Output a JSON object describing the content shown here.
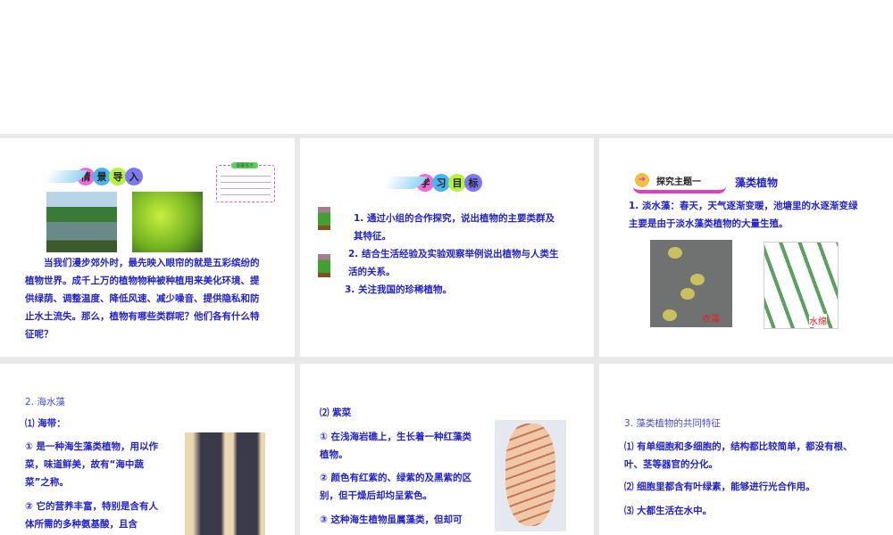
{
  "slides": [
    {
      "badge": [
        "情",
        "景",
        "导",
        "入"
      ],
      "note_title": "温馨提示",
      "text": "　　当我们漫步郊外时，最先映入眼帘的就是五彩缤纷的植物世界。成千上万的植物物种被种植用来美化环境、提供绿荫、调整温度、降低风速、减少噪音、提供隐私和防止水土流失。那么，植物有哪些类群呢？他们各有什么特征呢？"
    },
    {
      "badge": [
        "学",
        "习",
        "目",
        "标"
      ],
      "items": [
        "1. 通过小组的合作探究，说出植物的主要类群及其特征。",
        "2. 结合生活经验及实验观察举例说出植物与人类生活的关系。",
        "3. 关注我国的珍稀植物。"
      ]
    },
    {
      "badge_text": "探究主题一",
      "title": "藻类植物",
      "text": "1. 淡水藻：春天，天气逐渐变暖，池塘里的水逐渐变绿主要是由于淡水藻类植物的大量生殖。",
      "caption1": "衣藻",
      "caption2": "水绵"
    },
    {
      "heading": "2. 海水藻",
      "sub": "⑴ 海带：",
      "p1": "① 是一种海生藻类植物，用以作菜，味道鲜美，故有“海中蔬菜”之称。",
      "p2": "② 它的营养丰富，特别是含有人体所需的多种氨基酸，且含"
    },
    {
      "sub": "⑵ 紫菜",
      "p1": "① 在浅海岩礁上，生长着一种红藻类植物。",
      "p2": "② 颜色有红紫的、绿紫的及黑紫的区别，但干燥后却均呈紫色。",
      "p3": "③ 这种海生植物虽属藻类，但却可"
    },
    {
      "heading": "3. 藻类植物的共同特征",
      "p1": "⑴  有单细胞和多细胞的，结构都比较简单，都没有根、叶、茎等器官的分化。",
      "p2": "⑵  细胞里都含有叶绿素，能够进行光合作用。",
      "p3": "⑶  大都生活在水中。"
    }
  ]
}
